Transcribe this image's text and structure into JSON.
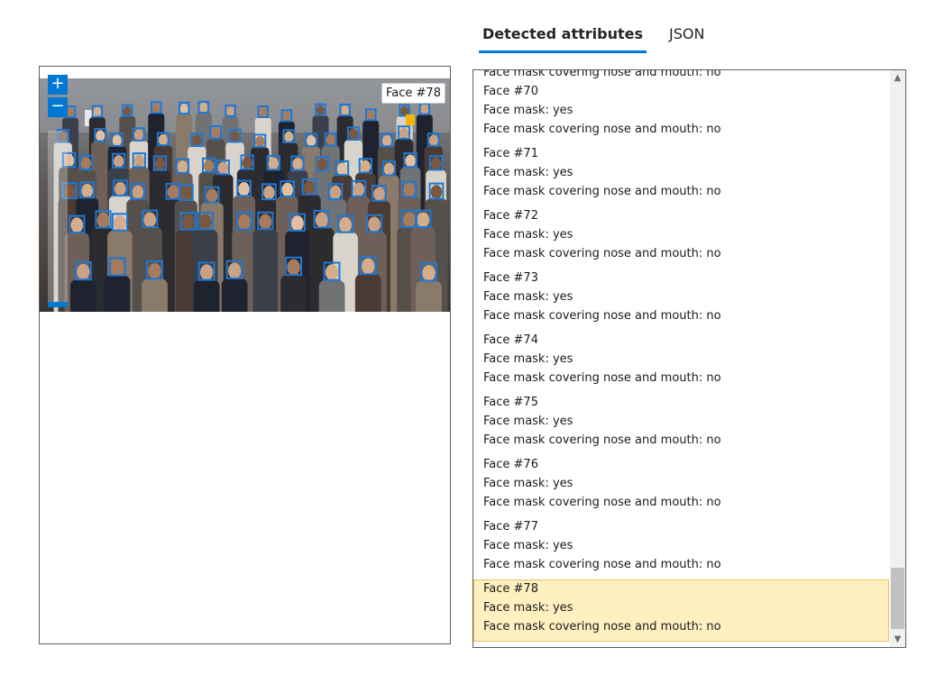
{
  "tabs": [
    {
      "label": "Detected attributes",
      "active": true
    },
    {
      "label": "JSON",
      "active": false
    }
  ],
  "image_viewer": {
    "zoom_in_label": "+",
    "zoom_out_label": "−",
    "tooltip": "Face #78",
    "face_box_color": "#1e78d4",
    "selected_face_color": "#f5b400"
  },
  "attributes": {
    "top_partial_line": "Face mask covering nose and mouth: no",
    "faces": [
      {
        "face": "Face #70",
        "mask": "Face mask: yes",
        "covering": "Face mask covering nose and mouth: no",
        "selected": false
      },
      {
        "face": "Face #71",
        "mask": "Face mask: yes",
        "covering": "Face mask covering nose and mouth: no",
        "selected": false
      },
      {
        "face": "Face #72",
        "mask": "Face mask: yes",
        "covering": "Face mask covering nose and mouth: no",
        "selected": false
      },
      {
        "face": "Face #73",
        "mask": "Face mask: yes",
        "covering": "Face mask covering nose and mouth: no",
        "selected": false
      },
      {
        "face": "Face #74",
        "mask": "Face mask: yes",
        "covering": "Face mask covering nose and mouth: no",
        "selected": false
      },
      {
        "face": "Face #75",
        "mask": "Face mask: yes",
        "covering": "Face mask covering nose and mouth: no",
        "selected": false
      },
      {
        "face": "Face #76",
        "mask": "Face mask: yes",
        "covering": "Face mask covering nose and mouth: no",
        "selected": false
      },
      {
        "face": "Face #77",
        "mask": "Face mask: yes",
        "covering": "Face mask covering nose and mouth: no",
        "selected": false
      },
      {
        "face": "Face #78",
        "mask": "Face mask: yes",
        "covering": "Face mask covering nose and mouth: no",
        "selected": true
      }
    ]
  },
  "colors": {
    "accent": "#0078d4",
    "selected_row_bg": "#fff0c0"
  }
}
